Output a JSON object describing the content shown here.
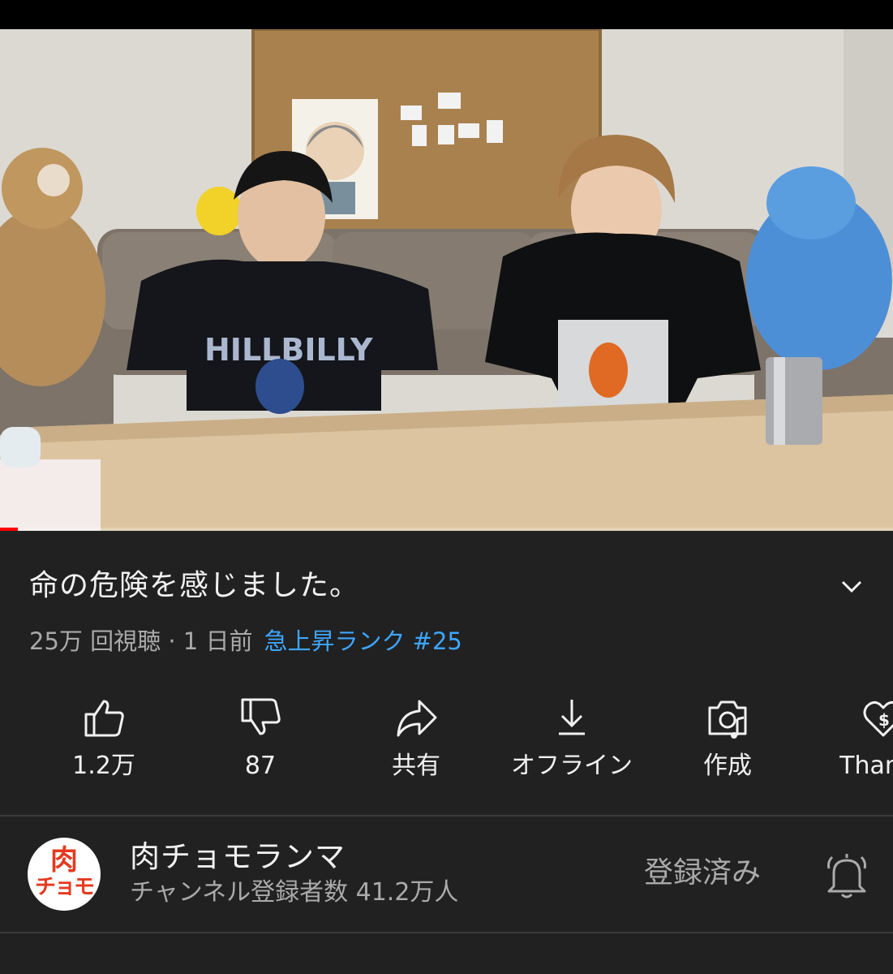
{
  "video": {
    "title": "命の危険を感じました。",
    "views": "25万 回視聴 · 1 日前",
    "trending": "急上昇ランク #25",
    "progress": 0.02,
    "thumbnail_text": "HILLBILLY"
  },
  "actions": [
    {
      "icon": "thumbs-up-icon",
      "label": "1.2万"
    },
    {
      "icon": "thumbs-down-icon",
      "label": "87"
    },
    {
      "icon": "share-icon",
      "label": "共有"
    },
    {
      "icon": "download-icon",
      "label": "オフライン"
    },
    {
      "icon": "create-icon",
      "label": "作成"
    },
    {
      "icon": "thanks-icon",
      "label": "Thanks"
    }
  ],
  "channel": {
    "name": "肉チョモランマ",
    "subscribers": "チャンネル登録者数 41.2万人",
    "avatar_line1": "肉",
    "avatar_line2": "チョモ",
    "subscribed_label": "登録済み"
  },
  "colors": {
    "background": "#212121",
    "accent_link": "#3ea6ff",
    "progress": "#ff0000",
    "secondary_text": "#aaaaaa"
  }
}
